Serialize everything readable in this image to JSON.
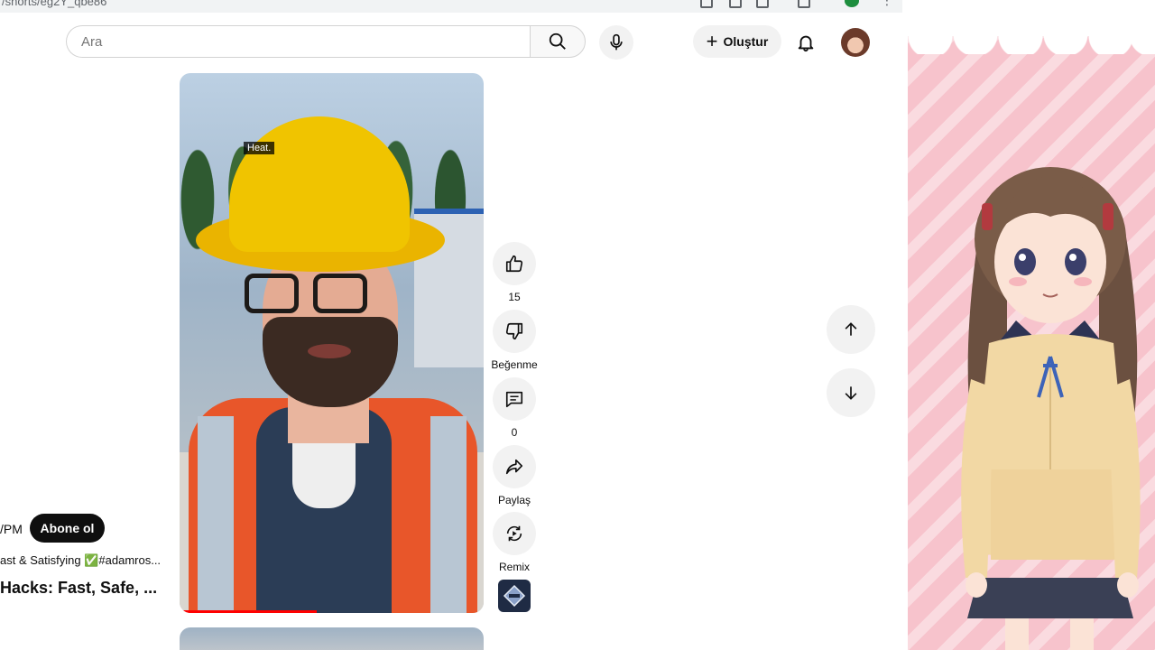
{
  "browser": {
    "url_fragment": "/shorts/eg2Y_qbe86"
  },
  "header": {
    "search_placeholder": "Ara",
    "create_label": "Oluştur",
    "icons": [
      "search-icon",
      "mic-icon",
      "plus-icon",
      "bell-icon",
      "avatar"
    ]
  },
  "video": {
    "caption": "Heat.",
    "progress_fraction": 0.45
  },
  "actions": {
    "like_count": "15",
    "dislike_label": "Beğenme",
    "comment_count": "0",
    "share_label": "Paylaş",
    "remix_label": "Remix"
  },
  "channel": {
    "name_partial": "/PM",
    "subscribe_label": "Abone ol",
    "description_partial": "ast & Satisfying ✅#adamros...",
    "title_partial": "Hacks: Fast, Safe, ..."
  },
  "navigation": {
    "up_icon": "arrow-up-icon",
    "down_icon": "arrow-down-icon"
  },
  "colors": {
    "subscribe_bg": "#0f0f0f",
    "progress": "#ff0000",
    "side_panel_pink": "#f7c3cc"
  }
}
